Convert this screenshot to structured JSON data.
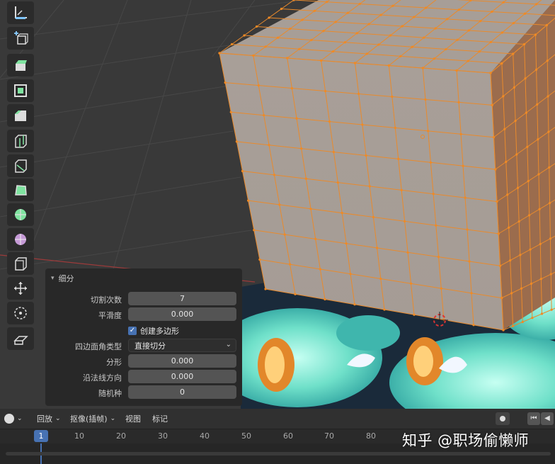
{
  "toolbar": {
    "tools": [
      {
        "icon": "measure-icon",
        "label": "Measure"
      },
      {
        "icon": "add-cube-icon",
        "label": "Add Cube"
      },
      {
        "icon": "extrude-icon",
        "label": "Extrude"
      },
      {
        "icon": "inset-icon",
        "label": "Inset"
      },
      {
        "icon": "bevel-icon",
        "label": "Bevel"
      },
      {
        "icon": "loop-cut-icon",
        "label": "Loop Cut"
      },
      {
        "icon": "knife-icon",
        "label": "Knife"
      },
      {
        "icon": "poly-build-icon",
        "label": "Poly Build"
      },
      {
        "icon": "spin-icon",
        "label": "Spin"
      },
      {
        "icon": "smooth-icon",
        "label": "Smooth"
      },
      {
        "icon": "edge-slide-icon",
        "label": "Edge Slide"
      },
      {
        "icon": "shrink-fatten-icon",
        "label": "Shrink/Fatten"
      },
      {
        "icon": "to-sphere-icon",
        "label": "To Sphere"
      },
      {
        "icon": "rip-icon",
        "label": "Rip"
      }
    ]
  },
  "panel": {
    "title": "细分",
    "cuts_label": "切割次数",
    "cuts_value": "7",
    "smoothness_label": "平滑度",
    "smoothness_value": "0.000",
    "create_ngons_label": "创建多边形",
    "create_ngons_checked": true,
    "quad_corner_label": "四边面角类型",
    "quad_corner_value": "直接切分",
    "fractal_label": "分形",
    "fractal_value": "0.000",
    "along_normal_label": "沿法线方向",
    "along_normal_value": "0.000",
    "random_seed_label": "随机种",
    "random_seed_value": "0"
  },
  "timeline": {
    "playback_label": "回放",
    "keying_label": "抠像(插帧)",
    "view_label": "视图",
    "marker_label": "标记",
    "current_frame": "1",
    "ruler_ticks": [
      "10",
      "20",
      "30",
      "40",
      "50",
      "60",
      "70",
      "80"
    ]
  },
  "watermark": "知乎 @职场偷懒师",
  "colors": {
    "viewport_bg": "#393939",
    "mesh_face": "#a79e97",
    "mesh_edge": "#f08a24",
    "panel_bg": "#282828",
    "accent_blue": "#4772b3",
    "texture_cyan": "#7fe3cf"
  }
}
